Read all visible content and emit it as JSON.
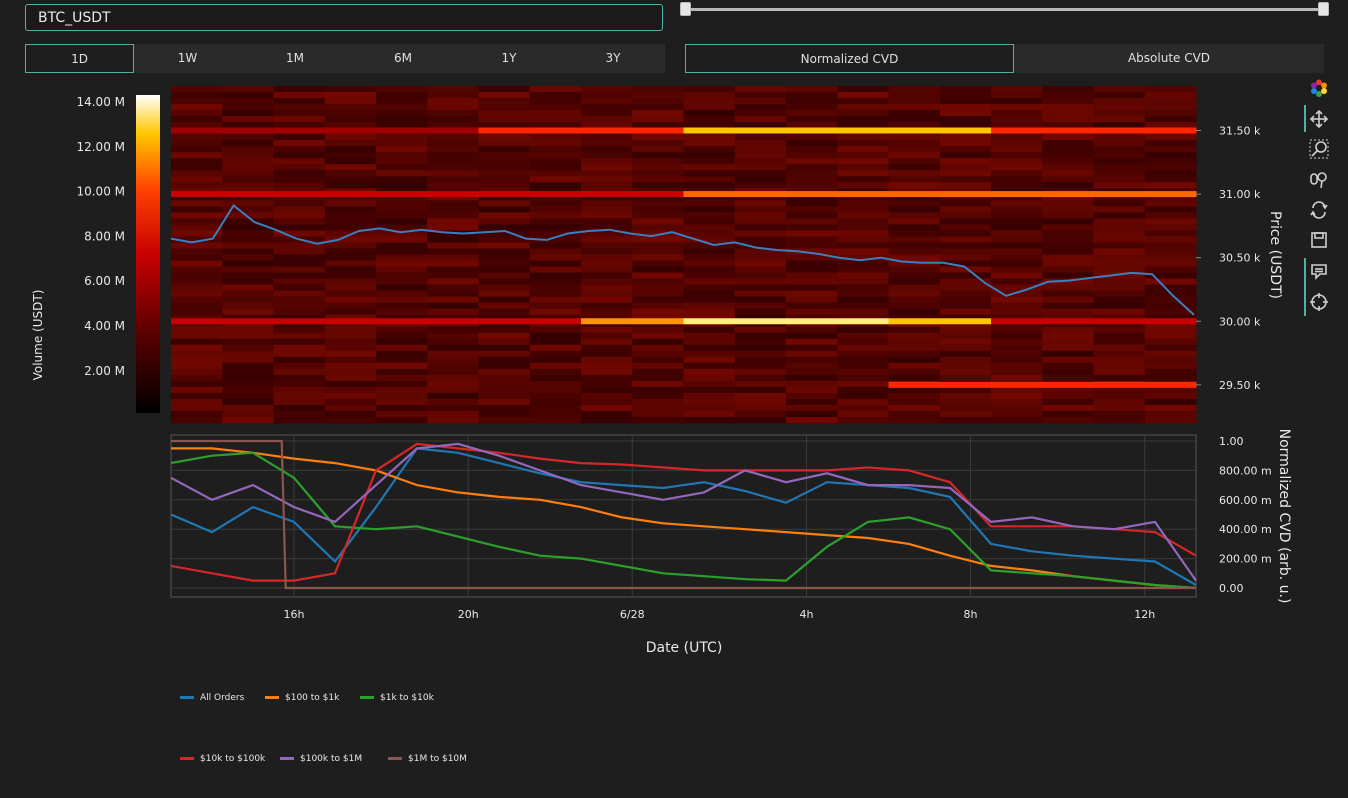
{
  "symbol": {
    "value": "BTC_USDT"
  },
  "timeframes": {
    "items": [
      "1D",
      "1W",
      "1M",
      "6M",
      "1Y",
      "3Y"
    ],
    "selected": "1D"
  },
  "cvd_modes": {
    "normalized": "Normalized CVD",
    "absolute": "Absolute CVD",
    "selected": "Normalized CVD"
  },
  "range_slider": {
    "start_fraction": 0,
    "end_fraction": 1
  },
  "colors": {
    "accent": "#4fb3a4",
    "all_orders": "#1f77b4",
    "r100_1k": "#ff7f0e",
    "r1k_10k": "#2ca02c",
    "r10k_100k": "#d62728",
    "r100k_1m": "#9467bd",
    "r1m_10m": "#8c564b"
  },
  "toolbar": {
    "icons": [
      "logo-icon",
      "pan-icon",
      "zoom-icon",
      "select-icon",
      "reset-icon",
      "save-icon",
      "hover-closest-icon",
      "spike-lines-icon"
    ]
  },
  "heatmap": {
    "colorbar_title": "Volume (USDT)",
    "colorbar_ticks": [
      "14.00 M",
      "12.00 M",
      "10.00 M",
      "8.00 M",
      "6.00 M",
      "4.00 M",
      "2.00 M"
    ],
    "price_axis_title": "Price (USDT)",
    "price_ticks": [
      "31.50 k",
      "31.00 k",
      "30.50 k",
      "30.00 k",
      "29.50 k"
    ]
  },
  "cvd_chart": {
    "yaxis_title": "Normalized CVD (arb. u.)",
    "yticks": [
      "1.00",
      "800.00 m",
      "600.00 m",
      "400.00 m",
      "200.00 m",
      "0.00"
    ],
    "xaxis_title": "Date (UTC)",
    "xticks": [
      "16h",
      "20h",
      "6/28",
      "4h",
      "8h",
      "12h"
    ]
  },
  "legend": {
    "items": [
      "All Orders",
      "$100 to $1k",
      "$1k to $10k",
      "$10k to $100k",
      "$100k to $1M",
      "$1M to $10M"
    ]
  },
  "chart_data": [
    {
      "type": "line",
      "title": "",
      "xlabel": "",
      "ylabel": "Price (USDT)",
      "x": [
        "12:30",
        "13:00",
        "13:30",
        "14:00",
        "14:30",
        "15:00",
        "15:30",
        "16:00",
        "16:30",
        "17:00",
        "17:30",
        "18:00",
        "18:30",
        "19:00",
        "19:30",
        "20:00",
        "20:30",
        "21:00",
        "21:30",
        "22:00",
        "22:30",
        "23:00",
        "23:30",
        "00:00",
        "00:30",
        "01:00",
        "01:30",
        "02:00",
        "02:30",
        "03:00",
        "03:30",
        "04:00",
        "04:30",
        "05:00",
        "05:30",
        "06:00",
        "06:30",
        "07:00",
        "07:30",
        "08:00",
        "08:30",
        "09:00",
        "09:30",
        "10:00",
        "10:30",
        "11:00",
        "11:30",
        "12:00",
        "12:30",
        "13:00"
      ],
      "series": [
        {
          "name": "",
          "values": [
            30650,
            30620,
            30650,
            30910,
            30780,
            30720,
            30650,
            30610,
            30640,
            30710,
            30730,
            30700,
            30720,
            30700,
            30690,
            30700,
            30710,
            30650,
            30640,
            30690,
            30710,
            30720,
            30690,
            30670,
            30700,
            30650,
            30600,
            30620,
            30580,
            30560,
            30550,
            30530,
            30500,
            30480,
            30500,
            30470,
            30460,
            30460,
            30430,
            30300,
            30200,
            30250,
            30310,
            30320,
            30340,
            30360,
            30380,
            30370,
            30200,
            30050
          ]
        }
      ],
      "ylim": [
        29200,
        31850
      ],
      "heatmap_levels": [
        {
          "price": 31500,
          "volume_m": [
            3,
            3,
            3,
            9,
            9,
            13,
            13,
            13,
            9,
            9
          ]
        },
        {
          "price": 31000,
          "volume_m": [
            6,
            6,
            6,
            6,
            6,
            11,
            11,
            11,
            11,
            11
          ]
        },
        {
          "price": 30000,
          "volume_m": [
            6,
            6,
            6,
            6,
            12,
            14,
            14,
            13,
            6,
            6
          ]
        },
        {
          "price": 29500,
          "volume_m": [
            0,
            0,
            0,
            0,
            0,
            0,
            0,
            9,
            9,
            9
          ]
        }
      ],
      "colorbar_range": [
        0,
        14.5
      ]
    },
    {
      "type": "line",
      "title": "",
      "xlabel": "Date (UTC)",
      "ylabel": "Normalized CVD (arb. u.)",
      "ylim": [
        0,
        1.0
      ],
      "x": [
        "12:30",
        "13:30",
        "14:30",
        "15:30",
        "16:30",
        "17:30",
        "18:30",
        "19:30",
        "20:30",
        "21:30",
        "22:30",
        "23:30",
        "00:30",
        "01:30",
        "02:30",
        "03:30",
        "04:30",
        "05:30",
        "06:30",
        "07:30",
        "08:30",
        "09:30",
        "10:30",
        "11:30",
        "12:30",
        "13:00"
      ],
      "series": [
        {
          "name": "All Orders",
          "values": [
            0.5,
            0.38,
            0.55,
            0.45,
            0.18,
            0.55,
            0.95,
            0.92,
            0.85,
            0.78,
            0.72,
            0.7,
            0.68,
            0.72,
            0.66,
            0.58,
            0.72,
            0.7,
            0.68,
            0.62,
            0.3,
            0.25,
            0.22,
            0.2,
            0.18,
            0.02
          ]
        },
        {
          "name": "$100 to $1k",
          "values": [
            0.95,
            0.95,
            0.92,
            0.88,
            0.85,
            0.8,
            0.7,
            0.65,
            0.62,
            0.6,
            0.55,
            0.48,
            0.44,
            0.42,
            0.4,
            0.38,
            0.36,
            0.34,
            0.3,
            0.22,
            0.15,
            0.12,
            0.08,
            0.05,
            0.02,
            0.0
          ]
        },
        {
          "name": "$1k to $10k",
          "values": [
            0.85,
            0.9,
            0.92,
            0.75,
            0.42,
            0.4,
            0.42,
            0.35,
            0.28,
            0.22,
            0.2,
            0.15,
            0.1,
            0.08,
            0.06,
            0.05,
            0.28,
            0.45,
            0.48,
            0.4,
            0.12,
            0.1,
            0.08,
            0.05,
            0.02,
            0.0
          ]
        },
        {
          "name": "$10k to $100k",
          "values": [
            0.15,
            0.1,
            0.05,
            0.05,
            0.1,
            0.8,
            0.98,
            0.95,
            0.92,
            0.88,
            0.85,
            0.84,
            0.82,
            0.8,
            0.8,
            0.8,
            0.8,
            0.82,
            0.8,
            0.72,
            0.42,
            0.42,
            0.42,
            0.4,
            0.38,
            0.22
          ]
        },
        {
          "name": "$100k to $1M",
          "values": [
            0.75,
            0.6,
            0.7,
            0.55,
            0.45,
            0.7,
            0.95,
            0.98,
            0.9,
            0.8,
            0.7,
            0.65,
            0.6,
            0.65,
            0.8,
            0.72,
            0.78,
            0.7,
            0.7,
            0.68,
            0.45,
            0.48,
            0.42,
            0.4,
            0.45,
            0.05
          ]
        },
        {
          "name": "$1M to $10M",
          "values": [
            1.0,
            1.0,
            1.0,
            1.0,
            0.0,
            0.0,
            0.0,
            0.0,
            0.0,
            0.0,
            0.0,
            0.0,
            0.0,
            0.0,
            0.0,
            0.0,
            0.0,
            0.0,
            0.0,
            0.0,
            0.0,
            0.0,
            0.0,
            0.0,
            0.0,
            0.0
          ]
        }
      ]
    }
  ]
}
